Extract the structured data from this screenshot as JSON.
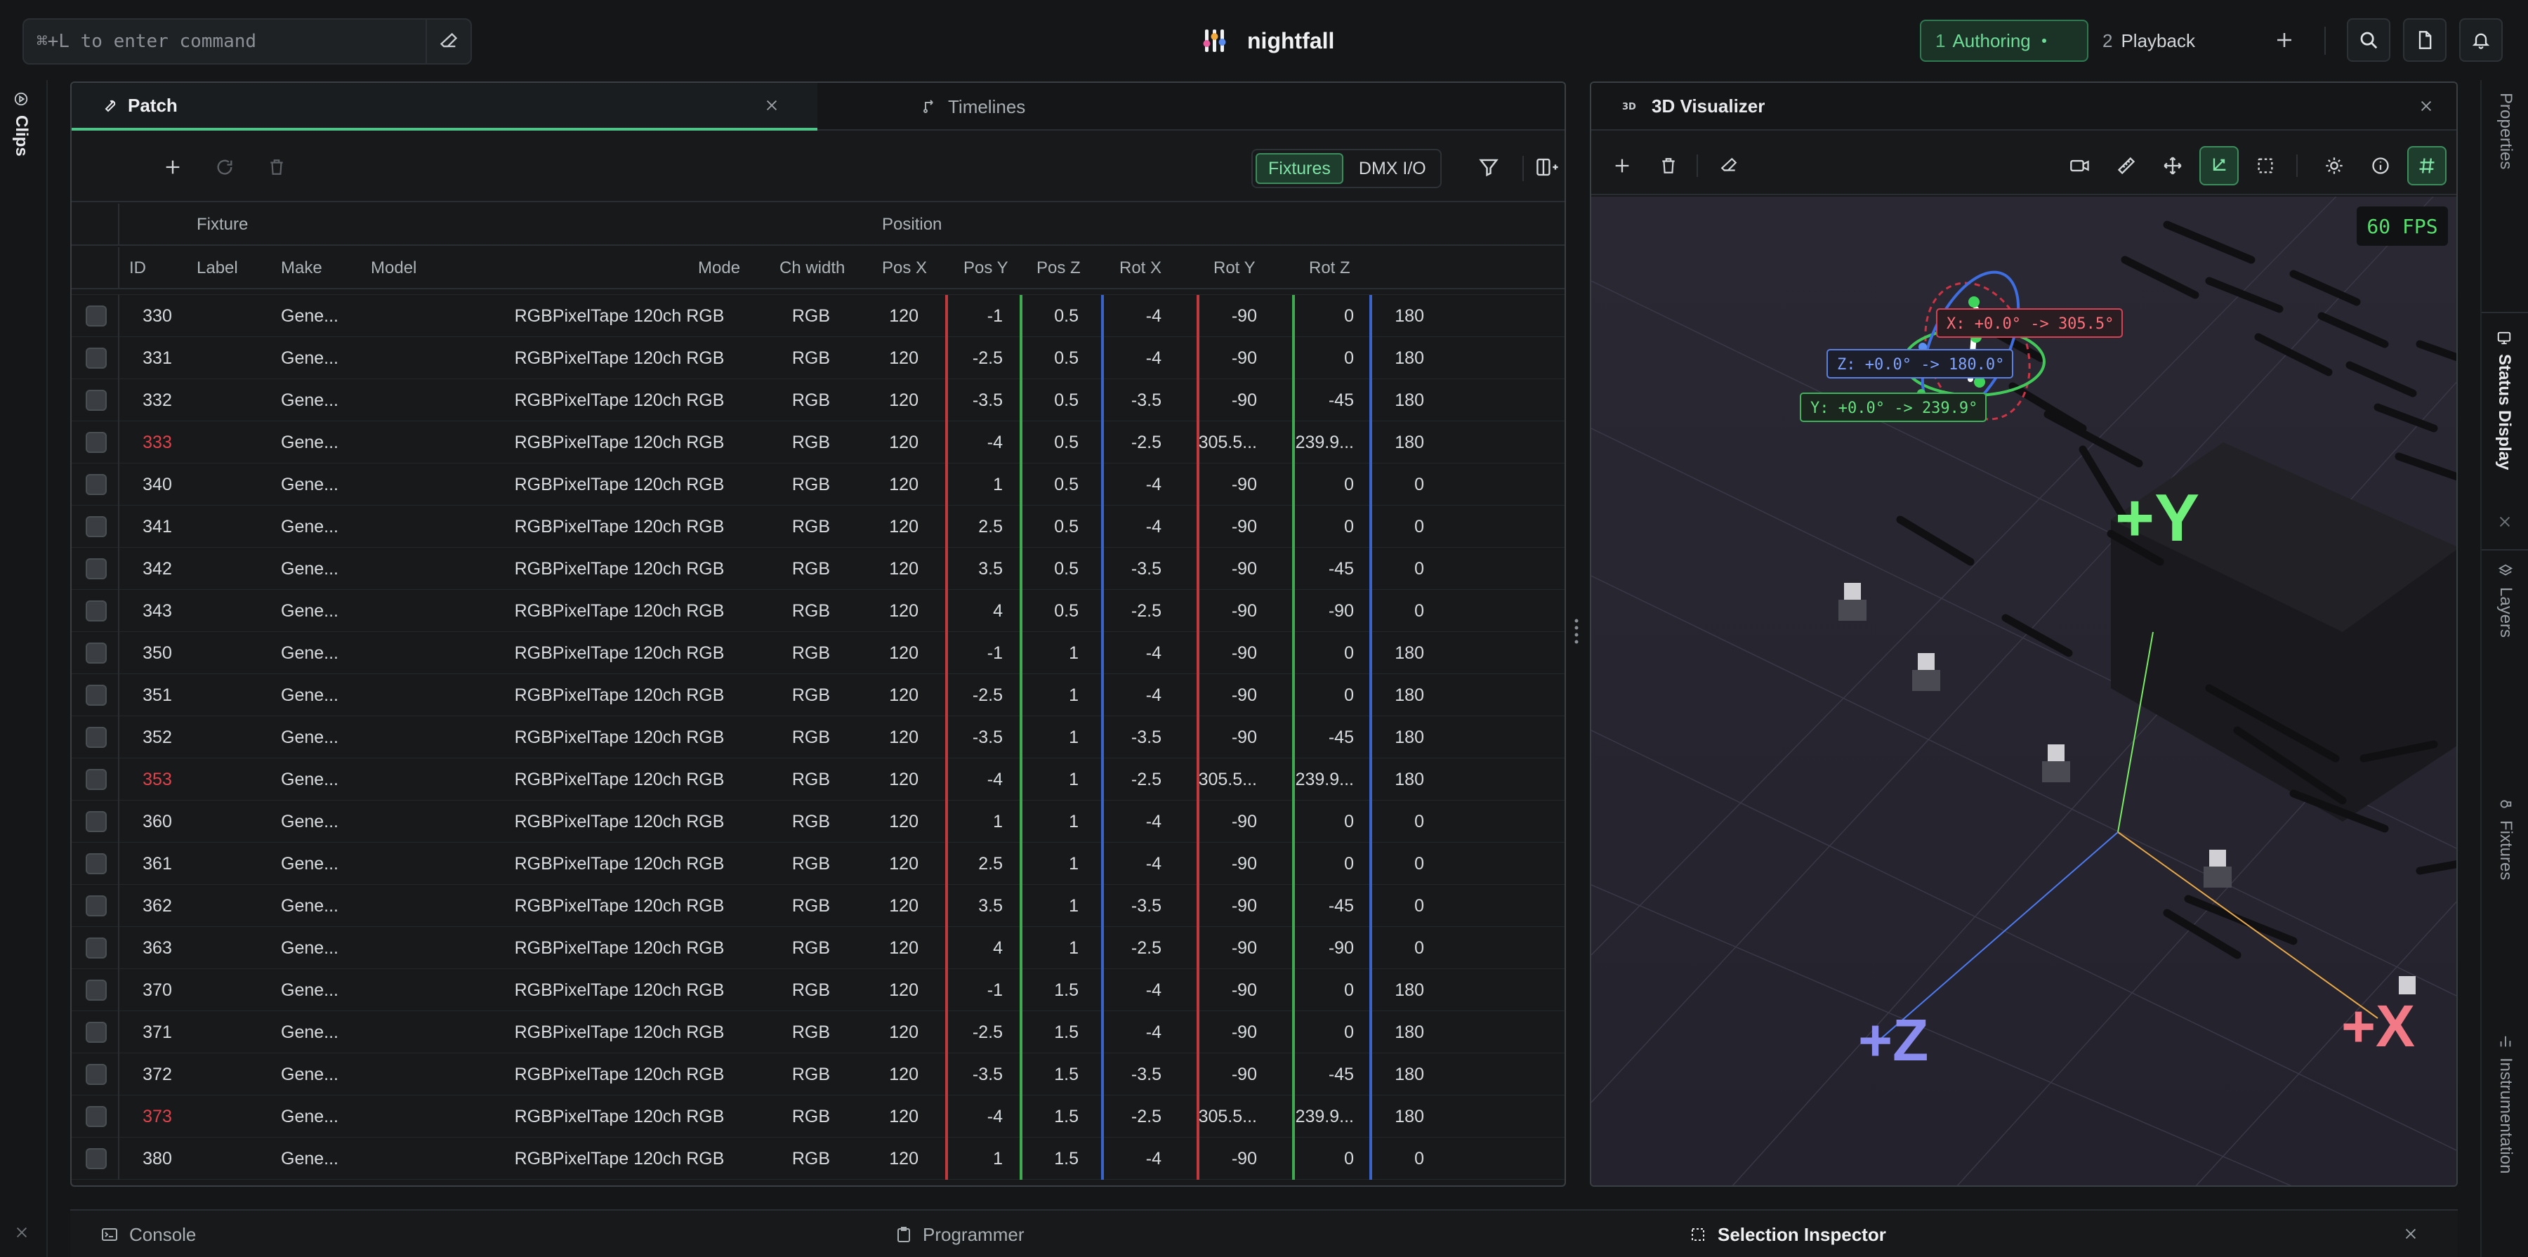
{
  "app": {
    "name": "nightfall"
  },
  "command": {
    "placeholder": "⌘+L to enter command"
  },
  "modes": [
    {
      "num": "1",
      "label": "Authoring",
      "active": true
    },
    {
      "num": "2",
      "label": "Playback",
      "active": false
    }
  ],
  "left_rail": {
    "clips": "Clips"
  },
  "right_rail": {
    "properties": "Properties",
    "status_display": "Status Display",
    "layers": "Layers",
    "fixtures": "Fixtures",
    "instrumentation": "Instrumentation"
  },
  "patch": {
    "tabs": {
      "patch": "Patch",
      "timelines": "Timelines"
    },
    "segment": {
      "fixtures": "Fixtures",
      "dmx": "DMX I/O"
    },
    "group_headers": {
      "fixture": "Fixture",
      "position": "Position"
    },
    "columns": {
      "id": "ID",
      "label": "Label",
      "make": "Make",
      "model": "Model",
      "mode": "Mode",
      "ch_width": "Ch width",
      "pos_x": "Pos X",
      "pos_y": "Pos Y",
      "pos_z": "Pos Z",
      "rot_x": "Rot X",
      "rot_y": "Rot Y",
      "rot_z": "Rot Z"
    },
    "rows": [
      {
        "id": "330",
        "label": "",
        "make": "Gene...",
        "model": "RGBPixelTape 120ch RGB",
        "mode": "RGB",
        "ch": "120",
        "px": "-1",
        "py": "0.5",
        "pz": "-4",
        "rx": "-90",
        "ry": "0",
        "rz": "180",
        "warn": false
      },
      {
        "id": "331",
        "label": "",
        "make": "Gene...",
        "model": "RGBPixelTape 120ch RGB",
        "mode": "RGB",
        "ch": "120",
        "px": "-2.5",
        "py": "0.5",
        "pz": "-4",
        "rx": "-90",
        "ry": "0",
        "rz": "180",
        "warn": false
      },
      {
        "id": "332",
        "label": "",
        "make": "Gene...",
        "model": "RGBPixelTape 120ch RGB",
        "mode": "RGB",
        "ch": "120",
        "px": "-3.5",
        "py": "0.5",
        "pz": "-3.5",
        "rx": "-90",
        "ry": "-45",
        "rz": "180",
        "warn": false
      },
      {
        "id": "333",
        "label": "",
        "make": "Gene...",
        "model": "RGBPixelTape 120ch RGB",
        "mode": "RGB",
        "ch": "120",
        "px": "-4",
        "py": "0.5",
        "pz": "-2.5",
        "rx": "305.5...",
        "ry": "239.9...",
        "rz": "180",
        "warn": true
      },
      {
        "id": "340",
        "label": "",
        "make": "Gene...",
        "model": "RGBPixelTape 120ch RGB",
        "mode": "RGB",
        "ch": "120",
        "px": "1",
        "py": "0.5",
        "pz": "-4",
        "rx": "-90",
        "ry": "0",
        "rz": "0",
        "warn": false
      },
      {
        "id": "341",
        "label": "",
        "make": "Gene...",
        "model": "RGBPixelTape 120ch RGB",
        "mode": "RGB",
        "ch": "120",
        "px": "2.5",
        "py": "0.5",
        "pz": "-4",
        "rx": "-90",
        "ry": "0",
        "rz": "0",
        "warn": false
      },
      {
        "id": "342",
        "label": "",
        "make": "Gene...",
        "model": "RGBPixelTape 120ch RGB",
        "mode": "RGB",
        "ch": "120",
        "px": "3.5",
        "py": "0.5",
        "pz": "-3.5",
        "rx": "-90",
        "ry": "-45",
        "rz": "0",
        "warn": false
      },
      {
        "id": "343",
        "label": "",
        "make": "Gene...",
        "model": "RGBPixelTape 120ch RGB",
        "mode": "RGB",
        "ch": "120",
        "px": "4",
        "py": "0.5",
        "pz": "-2.5",
        "rx": "-90",
        "ry": "-90",
        "rz": "0",
        "warn": false
      },
      {
        "id": "350",
        "label": "",
        "make": "Gene...",
        "model": "RGBPixelTape 120ch RGB",
        "mode": "RGB",
        "ch": "120",
        "px": "-1",
        "py": "1",
        "pz": "-4",
        "rx": "-90",
        "ry": "0",
        "rz": "180",
        "warn": false
      },
      {
        "id": "351",
        "label": "",
        "make": "Gene...",
        "model": "RGBPixelTape 120ch RGB",
        "mode": "RGB",
        "ch": "120",
        "px": "-2.5",
        "py": "1",
        "pz": "-4",
        "rx": "-90",
        "ry": "0",
        "rz": "180",
        "warn": false
      },
      {
        "id": "352",
        "label": "",
        "make": "Gene...",
        "model": "RGBPixelTape 120ch RGB",
        "mode": "RGB",
        "ch": "120",
        "px": "-3.5",
        "py": "1",
        "pz": "-3.5",
        "rx": "-90",
        "ry": "-45",
        "rz": "180",
        "warn": false
      },
      {
        "id": "353",
        "label": "",
        "make": "Gene...",
        "model": "RGBPixelTape 120ch RGB",
        "mode": "RGB",
        "ch": "120",
        "px": "-4",
        "py": "1",
        "pz": "-2.5",
        "rx": "305.5...",
        "ry": "239.9...",
        "rz": "180",
        "warn": true
      },
      {
        "id": "360",
        "label": "",
        "make": "Gene...",
        "model": "RGBPixelTape 120ch RGB",
        "mode": "RGB",
        "ch": "120",
        "px": "1",
        "py": "1",
        "pz": "-4",
        "rx": "-90",
        "ry": "0",
        "rz": "0",
        "warn": false
      },
      {
        "id": "361",
        "label": "",
        "make": "Gene...",
        "model": "RGBPixelTape 120ch RGB",
        "mode": "RGB",
        "ch": "120",
        "px": "2.5",
        "py": "1",
        "pz": "-4",
        "rx": "-90",
        "ry": "0",
        "rz": "0",
        "warn": false
      },
      {
        "id": "362",
        "label": "",
        "make": "Gene...",
        "model": "RGBPixelTape 120ch RGB",
        "mode": "RGB",
        "ch": "120",
        "px": "3.5",
        "py": "1",
        "pz": "-3.5",
        "rx": "-90",
        "ry": "-45",
        "rz": "0",
        "warn": false
      },
      {
        "id": "363",
        "label": "",
        "make": "Gene...",
        "model": "RGBPixelTape 120ch RGB",
        "mode": "RGB",
        "ch": "120",
        "px": "4",
        "py": "1",
        "pz": "-2.5",
        "rx": "-90",
        "ry": "-90",
        "rz": "0",
        "warn": false
      },
      {
        "id": "370",
        "label": "",
        "make": "Gene...",
        "model": "RGBPixelTape 120ch RGB",
        "mode": "RGB",
        "ch": "120",
        "px": "-1",
        "py": "1.5",
        "pz": "-4",
        "rx": "-90",
        "ry": "0",
        "rz": "180",
        "warn": false
      },
      {
        "id": "371",
        "label": "",
        "make": "Gene...",
        "model": "RGBPixelTape 120ch RGB",
        "mode": "RGB",
        "ch": "120",
        "px": "-2.5",
        "py": "1.5",
        "pz": "-4",
        "rx": "-90",
        "ry": "0",
        "rz": "180",
        "warn": false
      },
      {
        "id": "372",
        "label": "",
        "make": "Gene...",
        "model": "RGBPixelTape 120ch RGB",
        "mode": "RGB",
        "ch": "120",
        "px": "-3.5",
        "py": "1.5",
        "pz": "-3.5",
        "rx": "-90",
        "ry": "-45",
        "rz": "180",
        "warn": false
      },
      {
        "id": "373",
        "label": "",
        "make": "Gene...",
        "model": "RGBPixelTape 120ch RGB",
        "mode": "RGB",
        "ch": "120",
        "px": "-4",
        "py": "1.5",
        "pz": "-2.5",
        "rx": "305.5...",
        "ry": "239.9...",
        "rz": "180",
        "warn": true
      },
      {
        "id": "380",
        "label": "",
        "make": "Gene...",
        "model": "RGBPixelTape 120ch RGB",
        "mode": "RGB",
        "ch": "120",
        "px": "1",
        "py": "1.5",
        "pz": "-4",
        "rx": "-90",
        "ry": "0",
        "rz": "0",
        "warn": false
      }
    ]
  },
  "visualizer": {
    "title": "3D Visualizer",
    "fps": "60 FPS",
    "gizmo": {
      "x": "X: +0.0° -> 305.5°",
      "z": "Z: +0.0° -> 180.0°",
      "y": "Y: +0.0° -> 239.9°"
    },
    "axes": {
      "x": "+X",
      "y": "+Y",
      "z": "+Z"
    }
  },
  "bottom_tabs": {
    "console": "Console",
    "programmer": "Programmer",
    "inspector": "Selection Inspector"
  },
  "colors": {
    "accent": "#4fc488",
    "warn": "#e0434b",
    "axis_x": "#f27a86",
    "axis_y": "#6ff07a",
    "axis_z": "#8b8cf0",
    "col_red": "#c0393f",
    "col_green": "#3faa4f",
    "col_blue": "#3a63c9"
  }
}
